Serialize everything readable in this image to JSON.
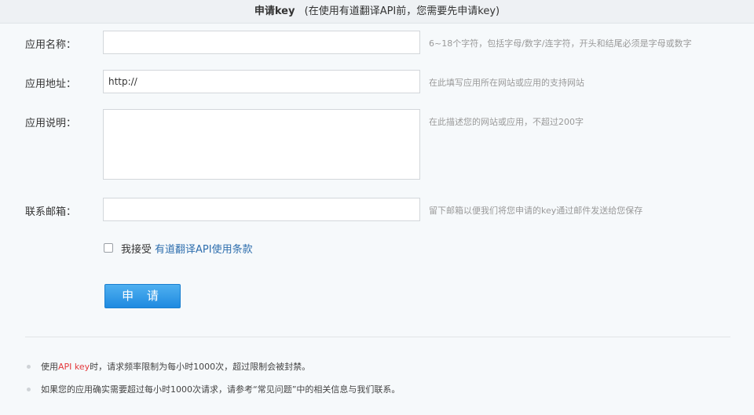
{
  "header": {
    "title": "申请key",
    "subtitle": "(在使用有道翻译API前，您需要先申请key)"
  },
  "form": {
    "app_name": {
      "label": "应用名称：",
      "value": "",
      "hint": "6~18个字符，包括字母/数字/连字符，开头和结尾必须是字母或数字"
    },
    "app_url": {
      "label": "应用地址：",
      "value": "http://",
      "hint": "在此填写应用所在网站或应用的支持网站"
    },
    "app_desc": {
      "label": "应用说明：",
      "value": "",
      "hint": "在此描述您的网站或应用，不超过200字"
    },
    "email": {
      "label": "联系邮箱：",
      "value": "",
      "hint": "留下邮箱以便我们将您申请的key通过邮件发送给您保存"
    },
    "agree": {
      "prefix": "我接受",
      "link": "有道翻译API使用条款",
      "checked": false
    },
    "submit_label": "申 请"
  },
  "notes": {
    "note1": {
      "before": "使用",
      "highlight": "API key",
      "after": "时，请求频率限制为每小时1000次，超过限制会被封禁。"
    },
    "note2": "如果您的应用确实需要超过每小时1000次请求，请参考“常见问题”中的相关信息与我们联系。"
  },
  "colors": {
    "accent_blue": "#1f8ae0",
    "link_blue": "#2f6fae",
    "highlight_red": "#e4393c"
  }
}
